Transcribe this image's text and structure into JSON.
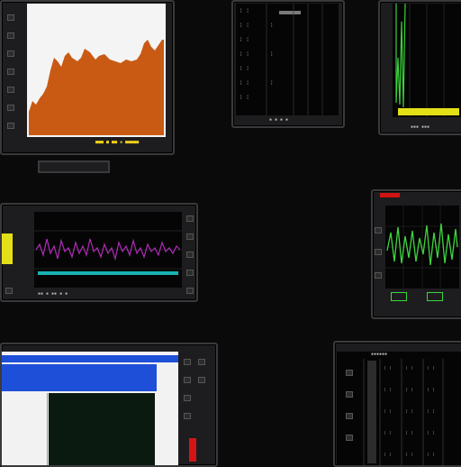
{
  "panels": {
    "spectrum": {
      "colors": {
        "fill": "#c95a14",
        "screen": "#f4f4f4",
        "status": "#f2d21b"
      }
    },
    "log_top": {
      "colors": {
        "header": "#7a7a7a"
      }
    },
    "green_scope": {
      "colors": {
        "trace": "#3bd13b",
        "bar": "#e3e017"
      }
    },
    "waveform": {
      "colors": {
        "trace": "#b02bb8",
        "baseline": "#18b3b3",
        "side": "#e3e017"
      }
    },
    "scope_right": {
      "colors": {
        "trace": "#3fd43f",
        "indicator": "#d01414"
      }
    },
    "blue_app": {
      "colors": {
        "titlebar": "#1e4fd8",
        "sheet": "#f2f2f2",
        "meter": "#d41414"
      }
    },
    "data_table": {
      "colors": {
        "grid": "#4a4a4a"
      }
    }
  }
}
